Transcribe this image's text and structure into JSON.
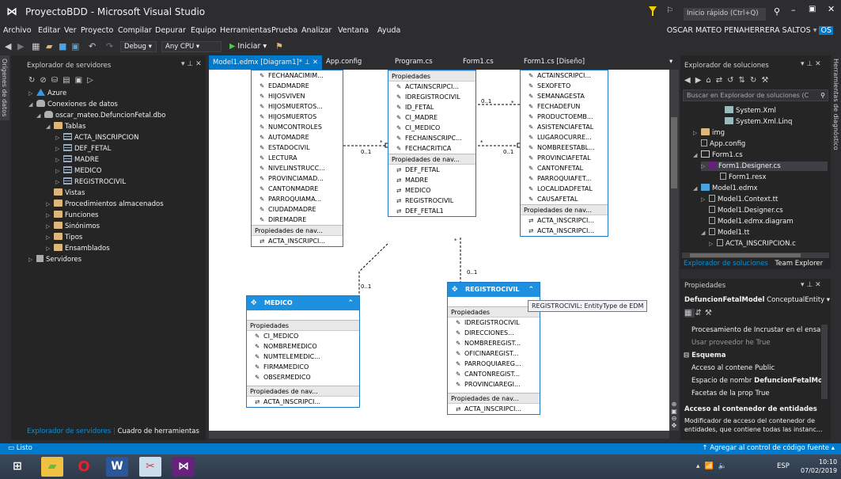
{
  "window": {
    "title": "ProyectoBDD - Microsoft Visual Studio",
    "quick_launch": "Inicio rápido (Ctrl+Q)"
  },
  "menu": [
    "Archivo",
    "Editar",
    "Ver",
    "Proyecto",
    "Compilar",
    "Depurar",
    "Equipo",
    "Herramientas",
    "Prueba",
    "Analizar",
    "Ventana",
    "Ayuda"
  ],
  "user": "OSCAR MATEO PENAHERRERA SALTOS",
  "user_initials": "OS",
  "toolbar": {
    "config": "Debug",
    "platform": "Any CPU",
    "start": "Iniciar"
  },
  "left_vtab": "Orígenes de datos",
  "right_vtab": "Herramientas de diagnóstico",
  "server_explorer": {
    "title": "Explorador de servidores",
    "items": [
      "Azure",
      "Conexiones de datos",
      "oscar_mateo.DefuncionFetal.dbo",
      "Tablas",
      "ACTA_INSCRIPCION",
      "DEF_FETAL",
      "MADRE",
      "MEDICO",
      "REGISTROCIVIL",
      "Vistas",
      "Procedimientos almacenados",
      "Funciones",
      "Sinónimos",
      "Tipos",
      "Ensamblados",
      "Servidores"
    ],
    "bottom_tabs": [
      "Explorador de servidores",
      "Cuadro de herramientas"
    ]
  },
  "doc_tabs": [
    "Model1.edmx [Diagram1]*",
    "App.config",
    "Program.cs",
    "Form1.cs",
    "Form1.cs [Diseño]"
  ],
  "section_props": "Propiedades",
  "section_nav": "Propiedades de nav...",
  "entities": {
    "madre": {
      "props": [
        "FECHANACIMIM...",
        "EDADMADRE",
        "HIJOSVIVEN",
        "HIJOSMUERTOS...",
        "HIJOSMUERTOS",
        "NUMCONTROLES",
        "AUTOMADRE",
        "ESTADOCIVIL",
        "LECTURA",
        "NIVELINSTRUCC...",
        "PROVINCIAMAD...",
        "CANTONMADRE",
        "PARROQUIAMA...",
        "CIUDADMADRE",
        "DIREMADRE"
      ],
      "nav": [
        "ACTA_INSCRIPCI..."
      ]
    },
    "acta": {
      "props": [
        "ACTAINSCRIPCI...",
        "IDREGISTROCIVIL",
        "ID_FETAL",
        "CI_MADRE",
        "CI_MEDICO",
        "FECHAINSCRIPC...",
        "FECHACRITICA"
      ],
      "nav": [
        "DEF_FETAL",
        "MADRE",
        "MEDICO",
        "REGISTROCIVIL",
        "DEF_FETAL1"
      ]
    },
    "def_fetal": {
      "props": [
        "ACTAINSCRIPCI...",
        "SEXOFETO",
        "SEMANAGESTA",
        "FECHADEFUN",
        "PRODUCTOEMB...",
        "ASISTENCIAFETAL",
        "LUGAROCURRE...",
        "NOMBREESTABL...",
        "PROVINCIAFETAL",
        "CANTONFETAL",
        "PARROQUIAFET...",
        "LOCALIDADFETAL",
        "CAUSAFETAL"
      ],
      "nav": [
        "ACTA_INSCRIPCI...",
        "ACTA_INSCRIPCI..."
      ]
    },
    "medico": {
      "name": "MEDICO",
      "props": [
        "CI_MEDICO",
        "NOMBREMEDICO",
        "NUMTELEMEDIC...",
        "FIRMAMEDICO",
        "OBSERMEDICO"
      ],
      "nav": [
        "ACTA_INSCRIPCI..."
      ]
    },
    "registro": {
      "name": "REGISTROCIVIL",
      "props": [
        "IDREGISTROCIVIL",
        "DIRECCIONES...",
        "NOMBREREGIST...",
        "OFICINAREGIST...",
        "PARROQUIAREG...",
        "CANTONREGIST...",
        "PROVINCIAREGI..."
      ],
      "nav": [
        "ACTA_INSCRIPCI..."
      ]
    }
  },
  "multiplicity": {
    "zero_one": "0..1",
    "many": "*"
  },
  "tooltip": "REGISTROCIVIL: EntityType de EDM",
  "solution_explorer": {
    "title": "Explorador de soluciones",
    "search": "Buscar en Explorador de soluciones (C",
    "items": [
      "System.Xml",
      "System.Xml.Linq",
      "img",
      "App.config",
      "Form1.cs",
      "Form1.Designer.cs",
      "Form1.resx",
      "Model1.edmx",
      "Model1.Context.tt",
      "Model1.Designer.cs",
      "Model1.edmx.diagram",
      "Model1.tt",
      "ACTA_INSCRIPCION.c"
    ],
    "bottom_tabs": [
      "Explorador de soluciones",
      "Team Explorer"
    ]
  },
  "properties": {
    "title": "Propiedades",
    "object": "DefuncionFetalModel",
    "object_type": "ConceptualEntity",
    "rows": [
      {
        "k": "Procesamiento de Incrustar en el ensa",
        "v": ""
      },
      {
        "k": "Usar proveedor he",
        "v": "True"
      },
      {
        "k": "Esquema",
        "v": ""
      },
      {
        "k": "Acceso al contene",
        "v": "Public"
      },
      {
        "k": "Espacio de nombr",
        "v": "DefuncionFetalMo"
      },
      {
        "k": "Facetas de la prop",
        "v": "True"
      }
    ],
    "desc_title": "Acceso al contenedor de entidades",
    "desc_text": "Modificador de acceso del contenedor de entidades, que contiene todas las instanc..."
  },
  "status": {
    "left": "Listo",
    "right": "Agregar al control de código fuente"
  },
  "taskbar": {
    "lang": "ESP",
    "time": "10:10",
    "date": "07/02/2019"
  },
  "colors": {
    "accent": "#007acc",
    "entity_header": "#1e90e0",
    "bg": "#2d2d30",
    "panel": "#252526"
  }
}
